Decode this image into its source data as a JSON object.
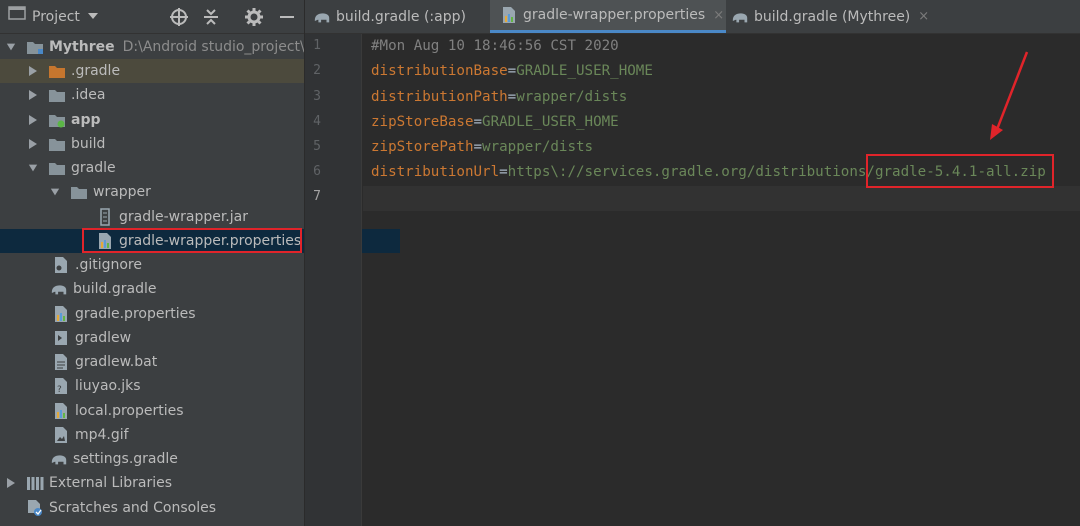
{
  "project_panel": {
    "title": "Project",
    "toolbar_icons": [
      "locate-icon",
      "collapse-icon",
      "gear-icon",
      "hide-icon"
    ]
  },
  "tree": [
    {
      "label": "Mythree",
      "path": "D:\\Android studio_project\\M",
      "icon": "module-folder-icon",
      "expanded": true
    },
    {
      "label": ".gradle",
      "icon": "folder-orange-icon",
      "expanded": false
    },
    {
      "label": ".idea",
      "icon": "folder-icon",
      "expanded": false
    },
    {
      "label": "app",
      "icon": "app-module-icon",
      "expanded": false
    },
    {
      "label": "build",
      "icon": "folder-icon",
      "expanded": false
    },
    {
      "label": "gradle",
      "icon": "folder-icon",
      "expanded": true
    },
    {
      "label": "wrapper",
      "icon": "folder-icon",
      "expanded": true
    },
    {
      "label": "gradle-wrapper.jar",
      "icon": "jar-icon"
    },
    {
      "label": "gradle-wrapper.properties",
      "icon": "properties-icon",
      "selected": true
    },
    {
      "label": ".gitignore",
      "icon": "gitignore-icon"
    },
    {
      "label": "build.gradle",
      "icon": "gradle-elephant-icon"
    },
    {
      "label": "gradle.properties",
      "icon": "properties-icon"
    },
    {
      "label": "gradlew",
      "icon": "script-icon"
    },
    {
      "label": "gradlew.bat",
      "icon": "text-file-icon"
    },
    {
      "label": "liuyao.jks",
      "icon": "keystore-icon"
    },
    {
      "label": "local.properties",
      "icon": "properties-icon"
    },
    {
      "label": "mp4.gif",
      "icon": "image-file-icon"
    },
    {
      "label": "settings.gradle",
      "icon": "gradle-elephant-icon"
    },
    {
      "label": "External Libraries",
      "icon": "libraries-icon",
      "expanded": false
    },
    {
      "label": "Scratches and Consoles",
      "icon": "scratches-icon"
    }
  ],
  "tabs": [
    {
      "label": "build.gradle (:app)",
      "icon": "gradle-elephant-icon",
      "active": false
    },
    {
      "label": "gradle-wrapper.properties",
      "icon": "properties-icon",
      "active": true
    },
    {
      "label": "build.gradle (Mythree)",
      "icon": "gradle-elephant-icon",
      "active": false
    }
  ],
  "tab_close": "×",
  "editor": {
    "line_numbers": [
      "1",
      "2",
      "3",
      "4",
      "5",
      "6",
      "7"
    ],
    "current_line": 7,
    "lines": [
      {
        "comment": "#Mon Aug 10 18:46:56 CST 2020"
      },
      {
        "key": "distributionBase",
        "eq": "=",
        "value": "GRADLE_USER_HOME"
      },
      {
        "key": "distributionPath",
        "eq": "=",
        "value": "wrapper/dists"
      },
      {
        "key": "zipStoreBase",
        "eq": "=",
        "value": "GRADLE_USER_HOME"
      },
      {
        "key": "zipStorePath",
        "eq": "=",
        "value": "wrapper/dists"
      },
      {
        "key": "distributionUrl",
        "eq": "=",
        "value": "https\\://services.gradle.org/distributions",
        "value_highlight": "/gradle-5.4.1-all.zip"
      },
      {}
    ]
  },
  "colors": {
    "annotation": "#e0242a",
    "key": "#cc7832",
    "value": "#6a8759",
    "comment": "#808080",
    "selection": "#0d293e"
  }
}
